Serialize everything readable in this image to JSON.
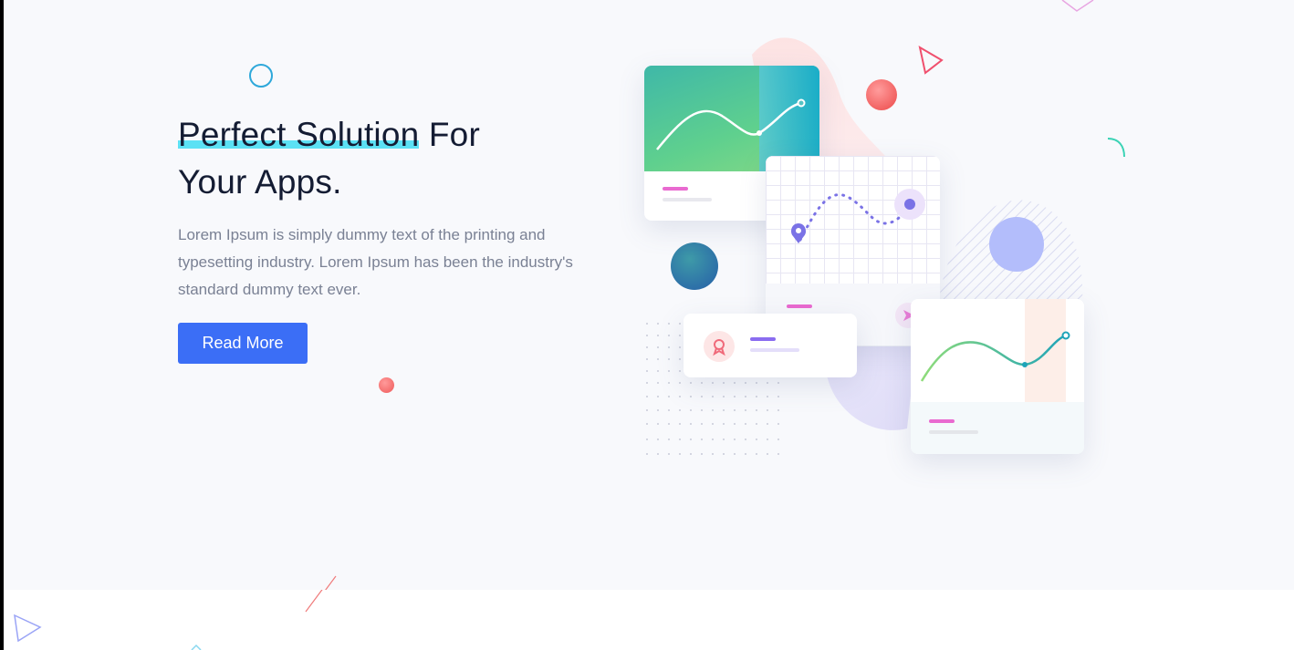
{
  "hero": {
    "title_highlight": "Perfect Solution",
    "title_rest_line1": " For",
    "title_line2": "Your Apps.",
    "description": "Lorem Ipsum is simply dummy text of the printing and typesetting industry. Lorem Ipsum has been the industry's standard dummy text ever.",
    "cta_label": "Read More"
  },
  "colors": {
    "accent": "#3b6ef6",
    "highlight": "#5ce1f4",
    "title": "#141c33",
    "body_text": "#7a8194",
    "background": "#f8f9fc"
  },
  "illustration": {
    "icons": [
      "line-chart-icon",
      "map-pin-icon",
      "send-icon",
      "award-icon"
    ]
  }
}
